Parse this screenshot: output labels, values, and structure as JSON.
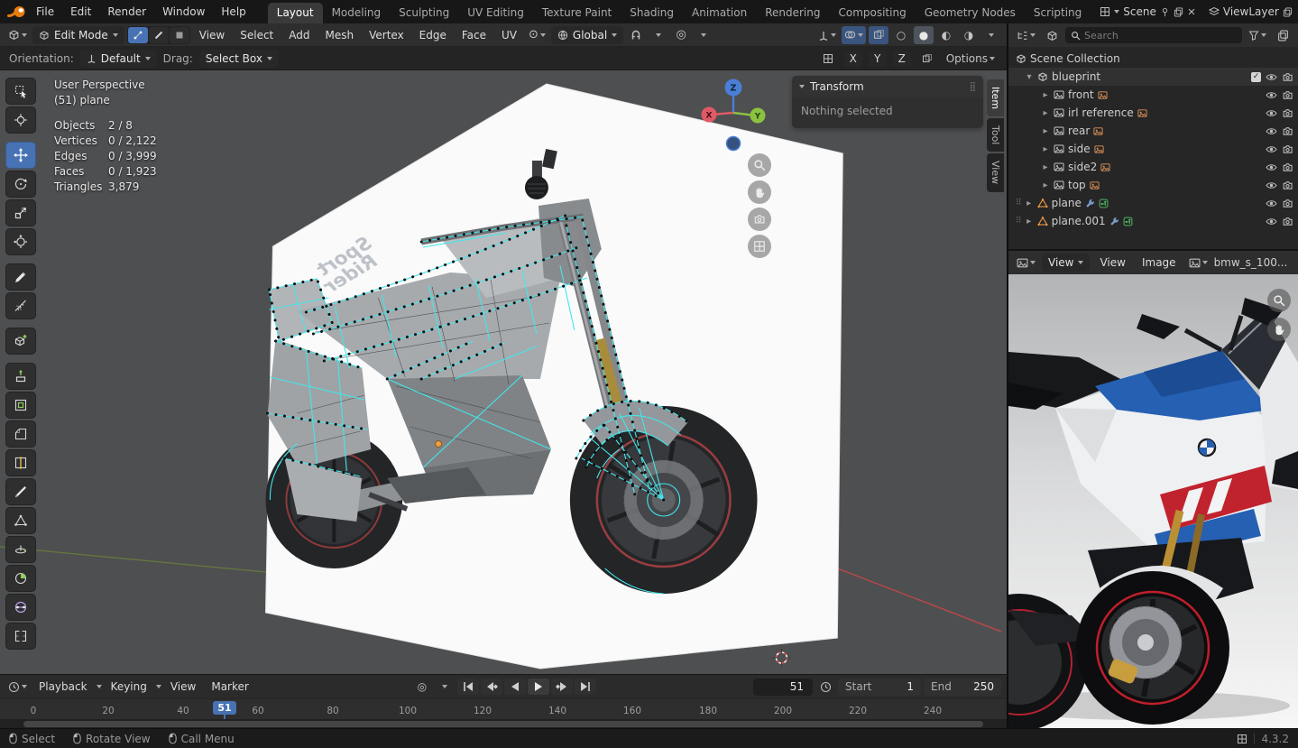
{
  "app": {
    "version": "4.3.2"
  },
  "icons": {
    "chevron": "▾",
    "expander_open": "▾",
    "expander_closed": "▸",
    "grip_dots": "⠿",
    "panel_grip": "⣿",
    "checkmark": "✓"
  },
  "colors": {
    "accent_blue": "#4772b3",
    "selected_edge_cyan": "#43e6ea",
    "axis_x_red": "#e05a66",
    "axis_y_green": "#8bc341",
    "axis_z_blue": "#4a7fd6",
    "data_orange": "#e0945a"
  },
  "topbar": {
    "menus": [
      "File",
      "Edit",
      "Render",
      "Window",
      "Help"
    ],
    "workspaces": [
      "Layout",
      "Modeling",
      "Sculpting",
      "UV Editing",
      "Texture Paint",
      "Shading",
      "Animation",
      "Rendering",
      "Compositing",
      "Geometry Nodes",
      "Scripting"
    ],
    "active_workspace": "Layout",
    "scene": {
      "label": "Scene"
    },
    "viewlayer": {
      "label": "ViewLayer"
    }
  },
  "viewport_header": {
    "mode_selector": "Edit Mode",
    "menus": [
      "View",
      "Select",
      "Add",
      "Mesh",
      "Vertex",
      "Edge",
      "Face",
      "UV"
    ],
    "orientation": "Global"
  },
  "tool_settings": {
    "orientation_label": "Orientation:",
    "orientation_value": "Default",
    "drag_label": "Drag:",
    "drag_value": "Select Box",
    "mirror_axes": [
      "X",
      "Y",
      "Z"
    ],
    "options_label": "Options"
  },
  "toolbar": {
    "tools": [
      "Select Box",
      "Cursor",
      "Move",
      "Rotate",
      "Scale",
      "Transform",
      "Annotate",
      "Measure",
      "Add Cube",
      "Extrude Region",
      "Inset Faces",
      "Bevel",
      "Loop Cut",
      "Knife",
      "Poly Build",
      "Spin",
      "Smooth",
      "Edge Slide",
      "Rip Region"
    ],
    "active_tool": "Move"
  },
  "viewport": {
    "view_label": "User Perspective",
    "object_label": "(51) plane",
    "stats": [
      {
        "label": "Objects",
        "value": "2 / 8"
      },
      {
        "label": "Vertices",
        "value": "0 / 2,122"
      },
      {
        "label": "Edges",
        "value": "0 / 3,999"
      },
      {
        "label": "Faces",
        "value": "0 / 1,923"
      },
      {
        "label": "Triangles",
        "value": "3,879"
      }
    ],
    "gizmo": {
      "x": "X",
      "y": "Y",
      "z": "Z"
    },
    "blueprint_text_line1": "Sport",
    "blueprint_text_line2": "Rider",
    "transform_panel": {
      "title": "Transform",
      "body": "Nothing selected"
    },
    "side_tabs": [
      "Item",
      "Tool",
      "View"
    ]
  },
  "outliner": {
    "search_placeholder": "Search",
    "rows": [
      {
        "label": "Scene Collection"
      },
      {
        "label": "blueprint"
      },
      {
        "label": "front"
      },
      {
        "label": "irl reference"
      },
      {
        "label": "rear"
      },
      {
        "label": "side"
      },
      {
        "label": "side2"
      },
      {
        "label": "top"
      },
      {
        "label": "plane"
      },
      {
        "label": "plane.001"
      }
    ]
  },
  "image_editor": {
    "mode": "View",
    "menus": [
      "View",
      "Image"
    ],
    "image_name": "bmw_s_100..."
  },
  "timeline": {
    "menus": [
      "Playback",
      "Keying",
      "View",
      "Marker"
    ],
    "current_frame": "51",
    "start_label": "Start",
    "start_value": "1",
    "end_label": "End",
    "end_value": "250",
    "ticks": [
      "0",
      "20",
      "40",
      "60",
      "80",
      "100",
      "120",
      "140",
      "160",
      "180",
      "200",
      "220",
      "240"
    ]
  },
  "statusbar": {
    "hints": [
      "Select",
      "Rotate View",
      "Call Menu"
    ],
    "version": "4.3.2"
  }
}
